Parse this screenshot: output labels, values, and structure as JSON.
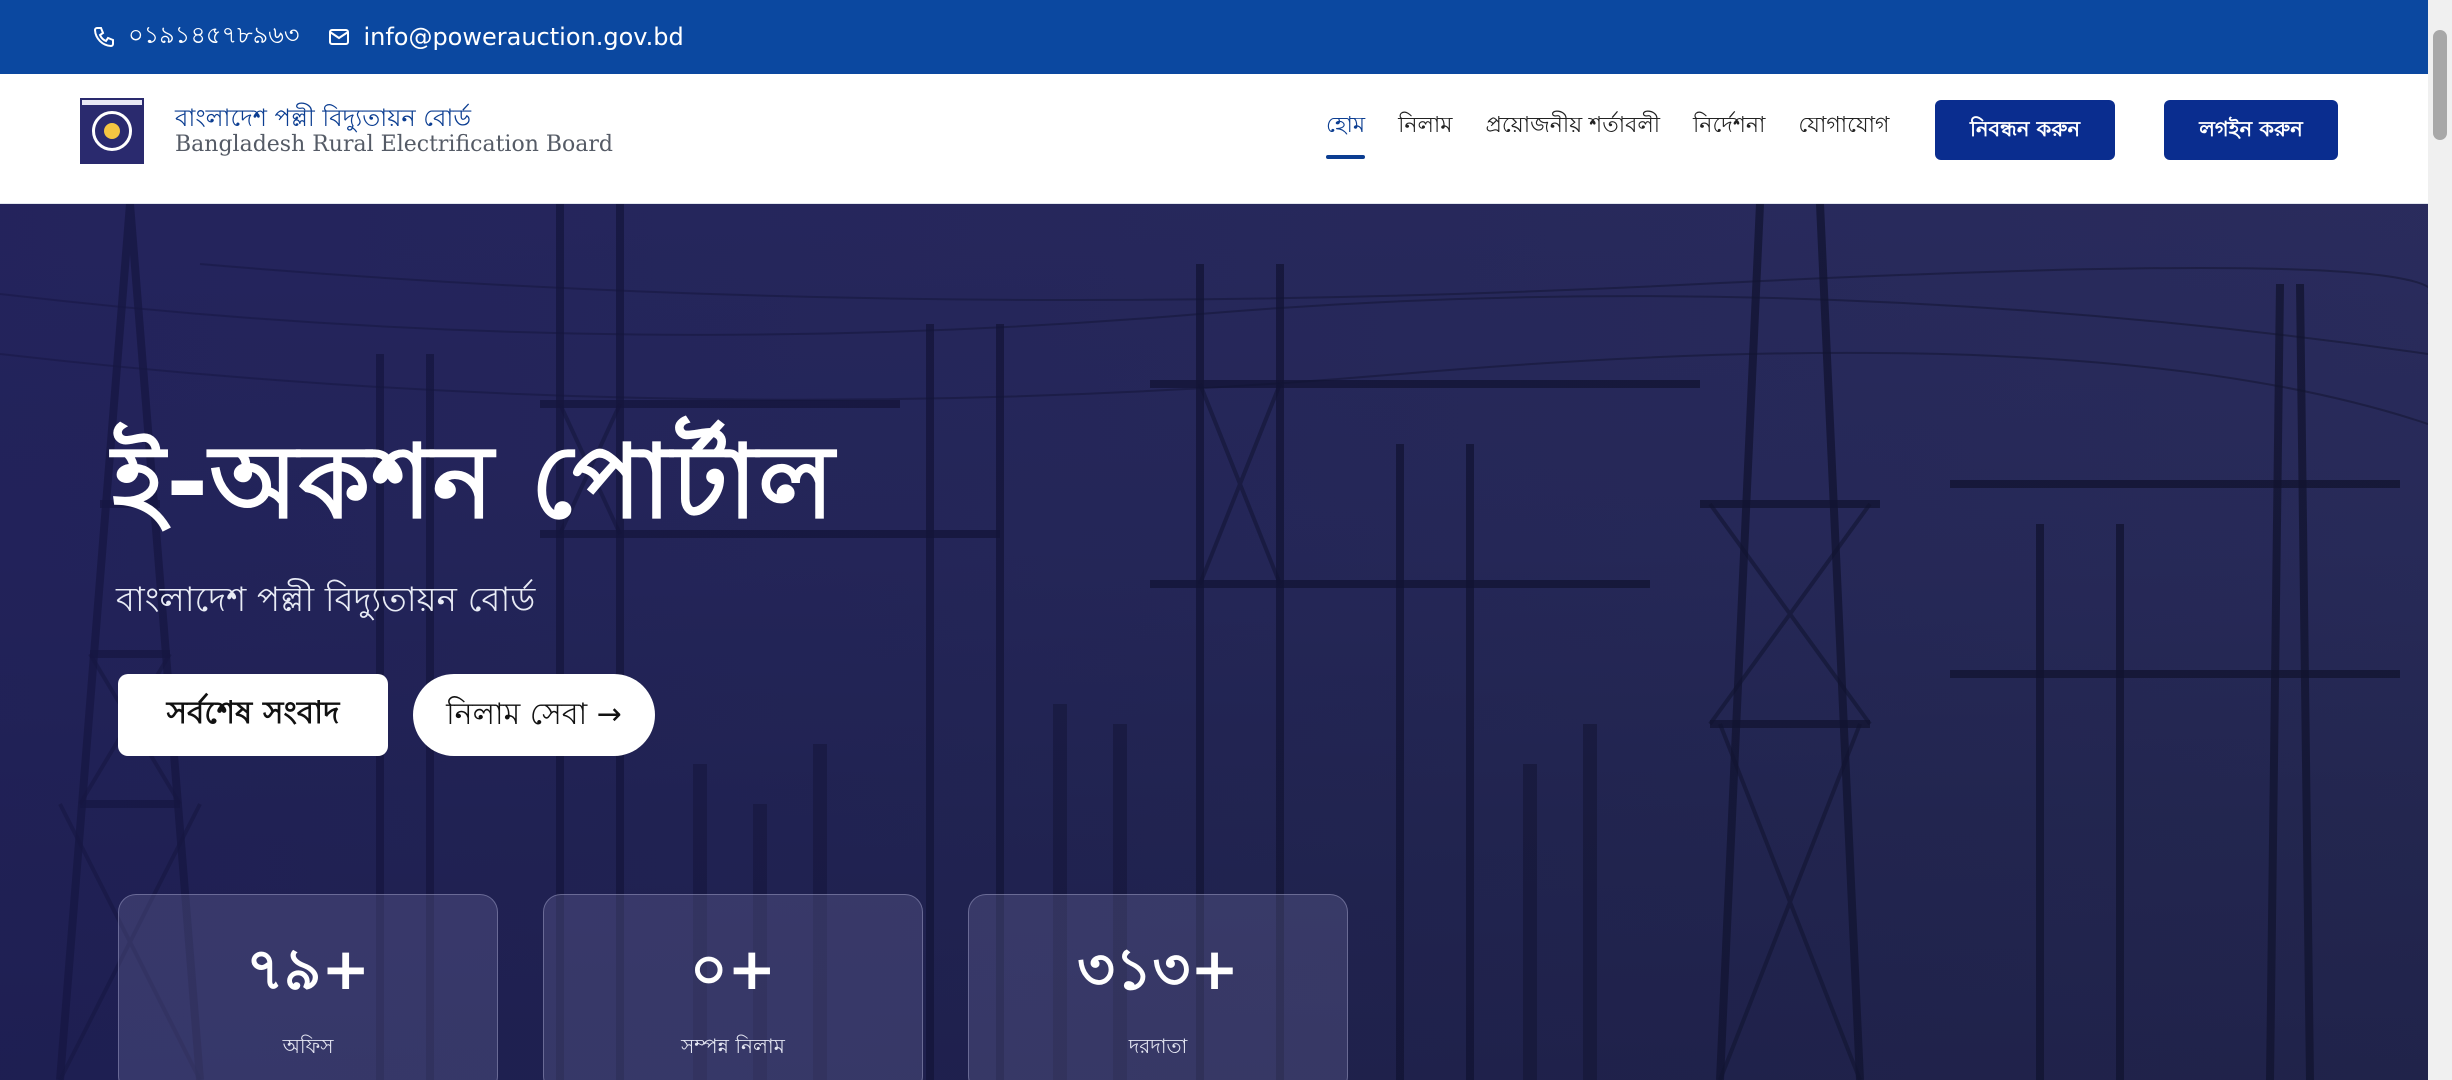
{
  "topbar": {
    "phone": "০১৯১৪৫৭৮৯৬৩",
    "email": "info@powerauction.gov.bd"
  },
  "header": {
    "brand_bn": "বাংলাদেশ পল্লী বিদ্যুতায়ন বোর্ড",
    "brand_en": "Bangladesh Rural Electrification Board",
    "nav": [
      {
        "label": "হোম"
      },
      {
        "label": "নিলাম"
      },
      {
        "label": "প্রয়োজনীয় শর্তাবলী"
      },
      {
        "label": "নির্দেশনা"
      },
      {
        "label": "যোগাযোগ"
      }
    ],
    "register_label": "নিবন্ধন করুন",
    "login_label": "লগইন করুন"
  },
  "hero": {
    "title": "ই-অকশন পোর্টাল",
    "subtitle": "বাংলাদেশ পল্লী বিদ্যুতায়ন বোর্ড",
    "news_button": "সর্বশেষ সংবাদ",
    "auction_button": "নিলাম সেবা →",
    "stats": [
      {
        "value": "৭৯+",
        "label": "অফিস"
      },
      {
        "value": "০+",
        "label": "সম্পন্ন নিলাম"
      },
      {
        "value": "৩১৩+",
        "label": "দরদাতা"
      }
    ]
  },
  "colors": {
    "topbar": "#0b48a0",
    "primary_button": "#0a2d8f",
    "nav_active": "#0b3d91"
  }
}
